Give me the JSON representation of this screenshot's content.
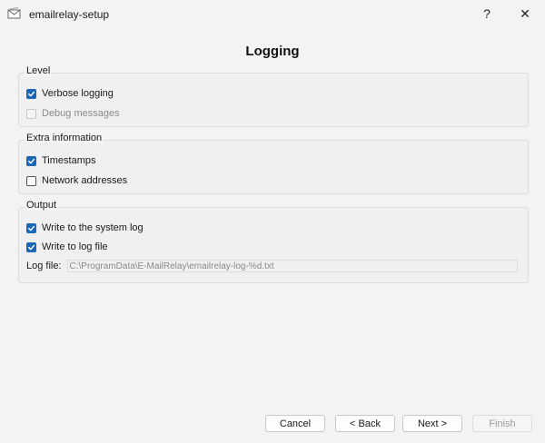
{
  "window": {
    "title": "emailrelay-setup",
    "help_glyph": "?",
    "close_glyph": "✕"
  },
  "page": {
    "title": "Logging"
  },
  "level": {
    "title": "Level",
    "verbose": {
      "label": "Verbose logging",
      "checked": true,
      "enabled": true
    },
    "debug": {
      "label": "Debug messages",
      "checked": false,
      "enabled": false
    }
  },
  "extra": {
    "title": "Extra information",
    "timestamps": {
      "label": "Timestamps",
      "checked": true,
      "enabled": true
    },
    "network": {
      "label": "Network addresses",
      "checked": false,
      "enabled": true
    }
  },
  "output": {
    "title": "Output",
    "syslog": {
      "label": "Write to the system log",
      "checked": true,
      "enabled": true
    },
    "logfile": {
      "label": "Write to log file",
      "checked": true,
      "enabled": true
    },
    "path_label": "Log file:",
    "path_value": "C:\\ProgramData\\E-MailRelay\\emailrelay-log-%d.txt"
  },
  "buttons": {
    "cancel": "Cancel",
    "back": "< Back",
    "next": "Next >",
    "finish": "Finish"
  },
  "colors": {
    "accent": "#1a67b8",
    "background": "#f3f3f3"
  }
}
